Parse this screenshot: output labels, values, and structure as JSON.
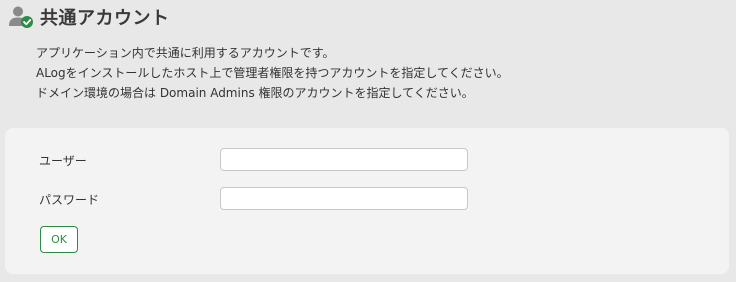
{
  "header": {
    "title": "共通アカウント",
    "icon": "user-check-icon"
  },
  "description": {
    "lines": [
      "アプリケーション内で共通に利用するアカウントです。",
      "ALogをインストールしたホスト上で管理者権限を持つアカウントを指定してください。",
      "ドメイン環境の場合は Domain Admins 権限のアカウントを指定してください。"
    ]
  },
  "form": {
    "user_label": "ユーザー",
    "user_value": "",
    "password_label": "パスワード",
    "password_value": "",
    "ok_label": "OK"
  },
  "colors": {
    "accent": "#2e8b45",
    "icon_gray": "#8a8a8a",
    "background": "#e8e8e8",
    "panel": "#f3f3f3"
  }
}
